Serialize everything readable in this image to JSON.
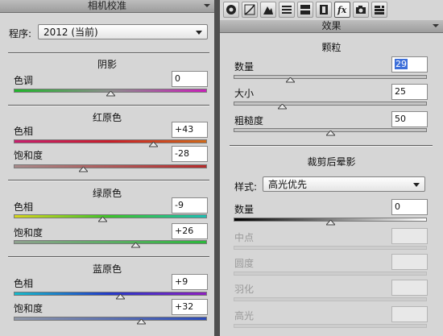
{
  "left": {
    "title": "相机校准",
    "program_label": "程序:",
    "program_value": "2012 (当前)",
    "shadows": {
      "title": "阴影",
      "tint": {
        "label": "色调",
        "value": "0",
        "level": 0.5
      }
    },
    "red": {
      "title": "红原色",
      "hue": {
        "label": "色相",
        "value": "+43",
        "level": 0.72
      },
      "saturation": {
        "label": "饱和度",
        "value": "-28",
        "level": 0.36
      }
    },
    "green": {
      "title": "绿原色",
      "hue": {
        "label": "色相",
        "value": "-9",
        "level": 0.46
      },
      "saturation": {
        "label": "饱和度",
        "value": "+26",
        "level": 0.63
      }
    },
    "blue": {
      "title": "蓝原色",
      "hue": {
        "label": "色相",
        "value": "+9",
        "level": 0.55
      },
      "saturation": {
        "label": "饱和度",
        "value": "+32",
        "level": 0.66
      }
    }
  },
  "right": {
    "title": "效果",
    "grain": {
      "title": "颗粒",
      "amount": {
        "label": "数量",
        "value": "29",
        "level": 0.29
      },
      "size": {
        "label": "大小",
        "value": "25",
        "level": 0.25
      },
      "roughness": {
        "label": "粗糙度",
        "value": "50",
        "level": 0.5
      }
    },
    "vignette": {
      "title": "裁剪后晕影",
      "style_label": "样式:",
      "style_value": "高光优先",
      "amount": {
        "label": "数量",
        "value": "0",
        "level": 0.5
      },
      "midpoint": {
        "label": "中点"
      },
      "roundness": {
        "label": "圆度"
      },
      "feather": {
        "label": "羽化"
      },
      "highlights": {
        "label": "高光"
      }
    }
  },
  "colors": {
    "panel_bg": "#d6d6d6",
    "selection": "#3d6fd9"
  },
  "toolbar_icons": [
    "basic-icon",
    "tone-curve-icon",
    "detail-icon",
    "hsl-icon",
    "split-toning-icon",
    "lens-corrections-icon",
    "effects-icon",
    "camera-calibration-icon",
    "presets-icon"
  ]
}
